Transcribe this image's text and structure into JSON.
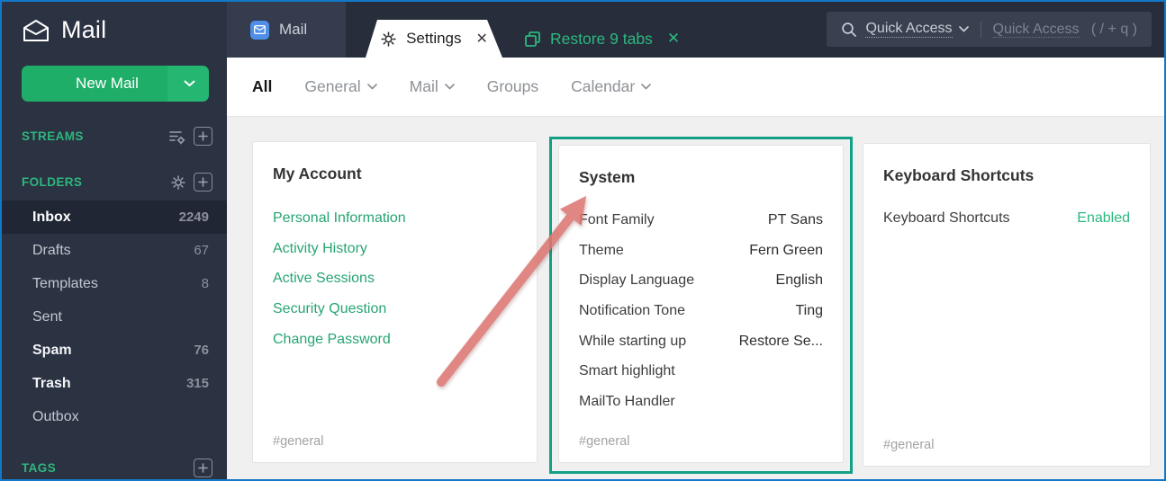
{
  "sidebar": {
    "logo_label": "Mail",
    "new_mail_label": "New Mail",
    "streams_label": "STREAMS",
    "folders_label": "FOLDERS",
    "tags_label": "TAGS",
    "folders": [
      {
        "label": "Inbox",
        "count": "2249"
      },
      {
        "label": "Drafts",
        "count": "67"
      },
      {
        "label": "Templates",
        "count": "8"
      },
      {
        "label": "Sent",
        "count": ""
      },
      {
        "label": "Spam",
        "count": "76"
      },
      {
        "label": "Trash",
        "count": "315"
      },
      {
        "label": "Outbox",
        "count": ""
      }
    ]
  },
  "topbar": {
    "mail_tab_label": "Mail",
    "settings_tab_label": "Settings",
    "settings_tab_close": "✕",
    "restore_tab_label": "Restore 9 tabs",
    "restore_tab_close": "✕",
    "quick_access_label": "Quick Access",
    "quick_access_placeholder": "Quick Access",
    "quick_access_hint": "( / + q )"
  },
  "filterbar": {
    "items": [
      {
        "label": "All"
      },
      {
        "label": "General"
      },
      {
        "label": "Mail"
      },
      {
        "label": "Groups"
      },
      {
        "label": "Calendar"
      }
    ]
  },
  "cards": {
    "my_account": {
      "title": "My Account",
      "links": [
        {
          "label": "Personal Information"
        },
        {
          "label": "Activity History"
        },
        {
          "label": "Active Sessions"
        },
        {
          "label": "Security Question"
        },
        {
          "label": "Change Password"
        }
      ],
      "footer": "#general"
    },
    "system": {
      "title": "System",
      "rows": [
        {
          "label": "Font Family",
          "value": "PT Sans"
        },
        {
          "label": "Theme",
          "value": "Fern Green"
        },
        {
          "label": "Display Language",
          "value": "English"
        },
        {
          "label": "Notification Tone",
          "value": "Ting"
        },
        {
          "label": "While starting up",
          "value": "Restore Se..."
        },
        {
          "label": "Smart highlight",
          "value": ""
        },
        {
          "label": "MailTo Handler",
          "value": ""
        }
      ],
      "footer": "#general"
    },
    "keyboard": {
      "title": "Keyboard Shortcuts",
      "rows": [
        {
          "label": "Keyboard Shortcuts",
          "value": "Enabled"
        }
      ],
      "footer": "#general"
    }
  },
  "colors": {
    "accent_green": "#26b274",
    "highlight_border": "#12a186",
    "arrow_red": "#dc7672",
    "screenshot_border": "#1478c8",
    "enabled_green": "#2ab87e"
  }
}
